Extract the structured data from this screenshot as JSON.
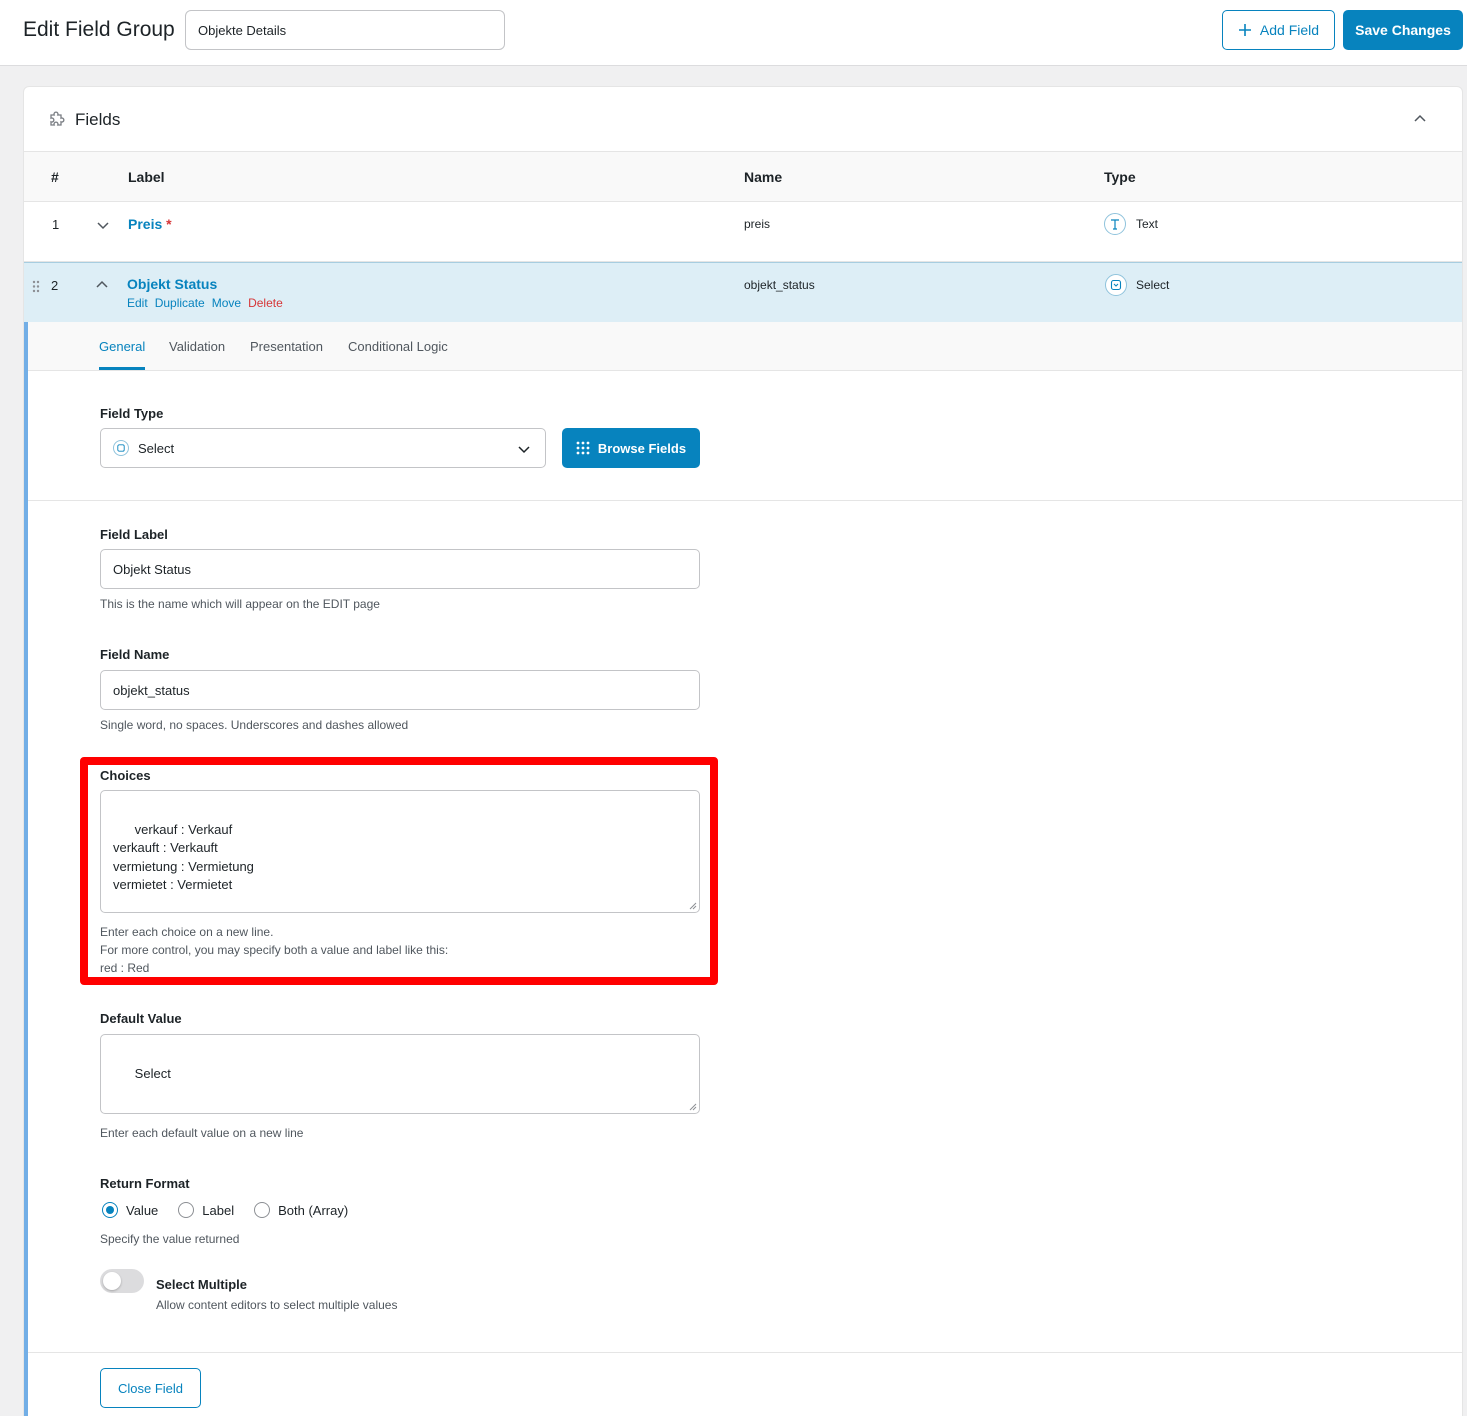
{
  "header": {
    "title": "Edit Field Group",
    "group_name": "Objekte Details",
    "add_field": "Add Field",
    "save_changes": "Save Changes"
  },
  "panel": {
    "title": "Fields"
  },
  "table": {
    "columns": {
      "num": "#",
      "label": "Label",
      "name": "Name",
      "type": "Type"
    },
    "rows": [
      {
        "num": "1",
        "label": "Preis",
        "required": "*",
        "name": "preis",
        "type": "Text"
      },
      {
        "num": "2",
        "label": "Objekt Status",
        "name": "objekt_status",
        "type": "Select",
        "actions": {
          "edit": "Edit",
          "duplicate": "Duplicate",
          "move": "Move",
          "delete": "Delete"
        }
      }
    ]
  },
  "settings": {
    "tabs": [
      "General",
      "Validation",
      "Presentation",
      "Conditional Logic"
    ],
    "active_tab": "General",
    "field_type": {
      "label": "Field Type",
      "value": "Select",
      "browse": "Browse Fields"
    },
    "field_label": {
      "label": "Field Label",
      "value": "Objekt Status",
      "help": "This is the name which will appear on the EDIT page"
    },
    "field_name": {
      "label": "Field Name",
      "value": "objekt_status",
      "help": "Single word, no spaces. Underscores and dashes allowed"
    },
    "choices": {
      "label": "Choices",
      "value": "verkauf : Verkauf\nverkauft : Verkauft\nvermietung : Vermietung\nvermietet : Vermietet",
      "help1": "Enter each choice on a new line.",
      "help2": "For more control, you may specify both a value and label like this:",
      "help3": "red : Red"
    },
    "default_value": {
      "label": "Default Value",
      "value": "Select",
      "help": "Enter each default value on a new line"
    },
    "return_format": {
      "label": "Return Format",
      "options": [
        "Value",
        "Label",
        "Both (Array)"
      ],
      "selected": "Value",
      "help": "Specify the value returned"
    },
    "select_multiple": {
      "label": "Select Multiple",
      "help": "Allow content editors to select multiple values",
      "enabled": false
    },
    "close_field": "Close Field"
  },
  "colors": {
    "accent": "#0783be",
    "delete": "#d63638",
    "highlight": "#ff0000"
  }
}
